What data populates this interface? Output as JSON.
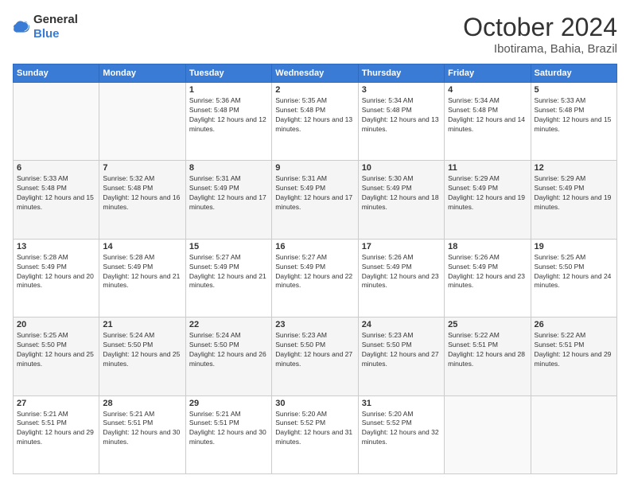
{
  "header": {
    "logo": {
      "general": "General",
      "blue": "Blue"
    },
    "title": "October 2024",
    "location": "Ibotirama, Bahia, Brazil"
  },
  "calendar": {
    "days_of_week": [
      "Sunday",
      "Monday",
      "Tuesday",
      "Wednesday",
      "Thursday",
      "Friday",
      "Saturday"
    ],
    "weeks": [
      [
        {
          "day": "",
          "sunrise": "",
          "sunset": "",
          "daylight": "",
          "empty": true
        },
        {
          "day": "",
          "sunrise": "",
          "sunset": "",
          "daylight": "",
          "empty": true
        },
        {
          "day": "1",
          "sunrise": "Sunrise: 5:36 AM",
          "sunset": "Sunset: 5:48 PM",
          "daylight": "Daylight: 12 hours and 12 minutes.",
          "empty": false
        },
        {
          "day": "2",
          "sunrise": "Sunrise: 5:35 AM",
          "sunset": "Sunset: 5:48 PM",
          "daylight": "Daylight: 12 hours and 13 minutes.",
          "empty": false
        },
        {
          "day": "3",
          "sunrise": "Sunrise: 5:34 AM",
          "sunset": "Sunset: 5:48 PM",
          "daylight": "Daylight: 12 hours and 13 minutes.",
          "empty": false
        },
        {
          "day": "4",
          "sunrise": "Sunrise: 5:34 AM",
          "sunset": "Sunset: 5:48 PM",
          "daylight": "Daylight: 12 hours and 14 minutes.",
          "empty": false
        },
        {
          "day": "5",
          "sunrise": "Sunrise: 5:33 AM",
          "sunset": "Sunset: 5:48 PM",
          "daylight": "Daylight: 12 hours and 15 minutes.",
          "empty": false
        }
      ],
      [
        {
          "day": "6",
          "sunrise": "Sunrise: 5:33 AM",
          "sunset": "Sunset: 5:48 PM",
          "daylight": "Daylight: 12 hours and 15 minutes.",
          "empty": false
        },
        {
          "day": "7",
          "sunrise": "Sunrise: 5:32 AM",
          "sunset": "Sunset: 5:48 PM",
          "daylight": "Daylight: 12 hours and 16 minutes.",
          "empty": false
        },
        {
          "day": "8",
          "sunrise": "Sunrise: 5:31 AM",
          "sunset": "Sunset: 5:49 PM",
          "daylight": "Daylight: 12 hours and 17 minutes.",
          "empty": false
        },
        {
          "day": "9",
          "sunrise": "Sunrise: 5:31 AM",
          "sunset": "Sunset: 5:49 PM",
          "daylight": "Daylight: 12 hours and 17 minutes.",
          "empty": false
        },
        {
          "day": "10",
          "sunrise": "Sunrise: 5:30 AM",
          "sunset": "Sunset: 5:49 PM",
          "daylight": "Daylight: 12 hours and 18 minutes.",
          "empty": false
        },
        {
          "day": "11",
          "sunrise": "Sunrise: 5:29 AM",
          "sunset": "Sunset: 5:49 PM",
          "daylight": "Daylight: 12 hours and 19 minutes.",
          "empty": false
        },
        {
          "day": "12",
          "sunrise": "Sunrise: 5:29 AM",
          "sunset": "Sunset: 5:49 PM",
          "daylight": "Daylight: 12 hours and 19 minutes.",
          "empty": false
        }
      ],
      [
        {
          "day": "13",
          "sunrise": "Sunrise: 5:28 AM",
          "sunset": "Sunset: 5:49 PM",
          "daylight": "Daylight: 12 hours and 20 minutes.",
          "empty": false
        },
        {
          "day": "14",
          "sunrise": "Sunrise: 5:28 AM",
          "sunset": "Sunset: 5:49 PM",
          "daylight": "Daylight: 12 hours and 21 minutes.",
          "empty": false
        },
        {
          "day": "15",
          "sunrise": "Sunrise: 5:27 AM",
          "sunset": "Sunset: 5:49 PM",
          "daylight": "Daylight: 12 hours and 21 minutes.",
          "empty": false
        },
        {
          "day": "16",
          "sunrise": "Sunrise: 5:27 AM",
          "sunset": "Sunset: 5:49 PM",
          "daylight": "Daylight: 12 hours and 22 minutes.",
          "empty": false
        },
        {
          "day": "17",
          "sunrise": "Sunrise: 5:26 AM",
          "sunset": "Sunset: 5:49 PM",
          "daylight": "Daylight: 12 hours and 23 minutes.",
          "empty": false
        },
        {
          "day": "18",
          "sunrise": "Sunrise: 5:26 AM",
          "sunset": "Sunset: 5:49 PM",
          "daylight": "Daylight: 12 hours and 23 minutes.",
          "empty": false
        },
        {
          "day": "19",
          "sunrise": "Sunrise: 5:25 AM",
          "sunset": "Sunset: 5:50 PM",
          "daylight": "Daylight: 12 hours and 24 minutes.",
          "empty": false
        }
      ],
      [
        {
          "day": "20",
          "sunrise": "Sunrise: 5:25 AM",
          "sunset": "Sunset: 5:50 PM",
          "daylight": "Daylight: 12 hours and 25 minutes.",
          "empty": false
        },
        {
          "day": "21",
          "sunrise": "Sunrise: 5:24 AM",
          "sunset": "Sunset: 5:50 PM",
          "daylight": "Daylight: 12 hours and 25 minutes.",
          "empty": false
        },
        {
          "day": "22",
          "sunrise": "Sunrise: 5:24 AM",
          "sunset": "Sunset: 5:50 PM",
          "daylight": "Daylight: 12 hours and 26 minutes.",
          "empty": false
        },
        {
          "day": "23",
          "sunrise": "Sunrise: 5:23 AM",
          "sunset": "Sunset: 5:50 PM",
          "daylight": "Daylight: 12 hours and 27 minutes.",
          "empty": false
        },
        {
          "day": "24",
          "sunrise": "Sunrise: 5:23 AM",
          "sunset": "Sunset: 5:50 PM",
          "daylight": "Daylight: 12 hours and 27 minutes.",
          "empty": false
        },
        {
          "day": "25",
          "sunrise": "Sunrise: 5:22 AM",
          "sunset": "Sunset: 5:51 PM",
          "daylight": "Daylight: 12 hours and 28 minutes.",
          "empty": false
        },
        {
          "day": "26",
          "sunrise": "Sunrise: 5:22 AM",
          "sunset": "Sunset: 5:51 PM",
          "daylight": "Daylight: 12 hours and 29 minutes.",
          "empty": false
        }
      ],
      [
        {
          "day": "27",
          "sunrise": "Sunrise: 5:21 AM",
          "sunset": "Sunset: 5:51 PM",
          "daylight": "Daylight: 12 hours and 29 minutes.",
          "empty": false
        },
        {
          "day": "28",
          "sunrise": "Sunrise: 5:21 AM",
          "sunset": "Sunset: 5:51 PM",
          "daylight": "Daylight: 12 hours and 30 minutes.",
          "empty": false
        },
        {
          "day": "29",
          "sunrise": "Sunrise: 5:21 AM",
          "sunset": "Sunset: 5:51 PM",
          "daylight": "Daylight: 12 hours and 30 minutes.",
          "empty": false
        },
        {
          "day": "30",
          "sunrise": "Sunrise: 5:20 AM",
          "sunset": "Sunset: 5:52 PM",
          "daylight": "Daylight: 12 hours and 31 minutes.",
          "empty": false
        },
        {
          "day": "31",
          "sunrise": "Sunrise: 5:20 AM",
          "sunset": "Sunset: 5:52 PM",
          "daylight": "Daylight: 12 hours and 32 minutes.",
          "empty": false
        },
        {
          "day": "",
          "sunrise": "",
          "sunset": "",
          "daylight": "",
          "empty": true
        },
        {
          "day": "",
          "sunrise": "",
          "sunset": "",
          "daylight": "",
          "empty": true
        }
      ]
    ]
  }
}
